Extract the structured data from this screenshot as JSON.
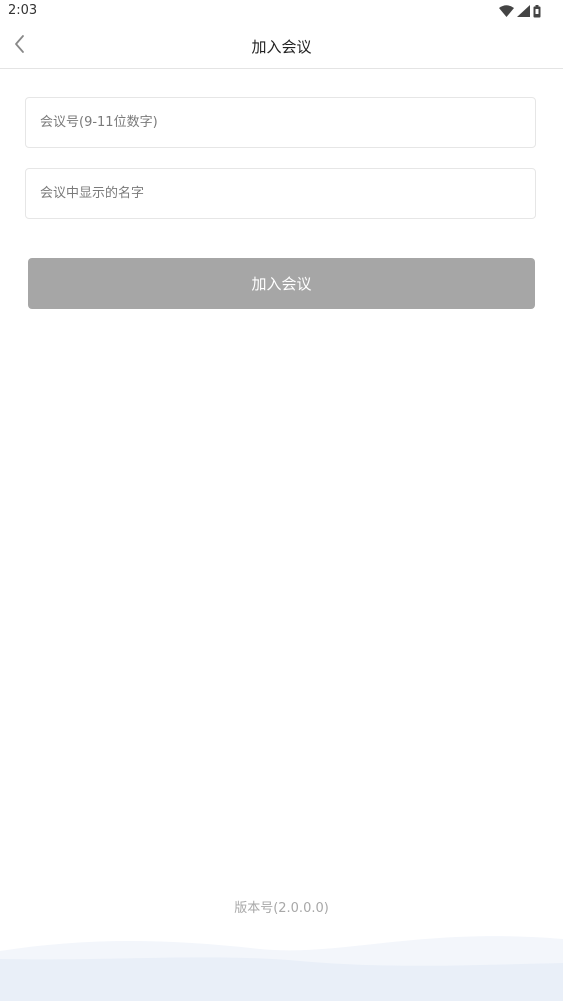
{
  "status_bar": {
    "time": "2:03",
    "icons": [
      "wifi-icon",
      "signal-icon",
      "battery-icon"
    ]
  },
  "nav": {
    "title": "加入会议",
    "back_icon": "chevron-left-icon"
  },
  "form": {
    "meeting_number_placeholder": "会议号(9-11位数字)",
    "meeting_number_value": "",
    "display_name_placeholder": "会议中显示的名字",
    "display_name_value": "",
    "join_button_label": "加入会议"
  },
  "footer": {
    "version_label": "版本号(2.0.0.0)"
  },
  "colors": {
    "join_button_disabled": "#a6a6a6",
    "wave_light": "#f3f6fb",
    "wave_dark": "#e7eef8"
  }
}
